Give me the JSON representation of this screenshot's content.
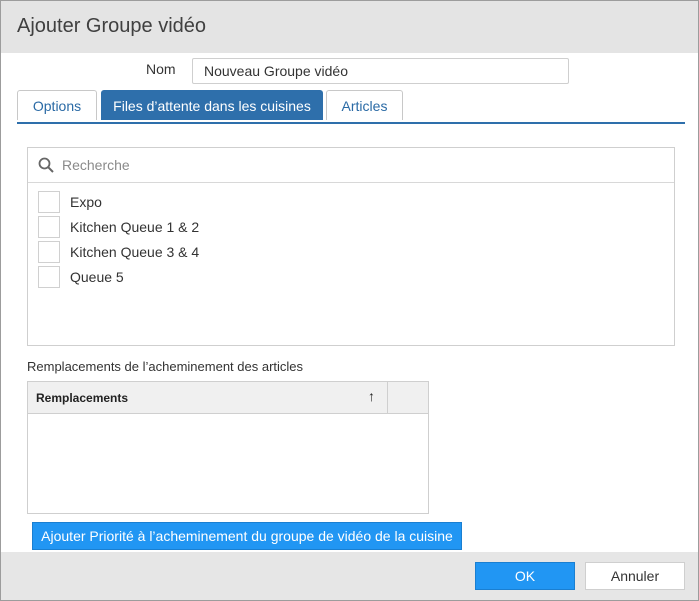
{
  "dialog": {
    "title": "Ajouter Groupe vidéo"
  },
  "name_field": {
    "label": "Nom",
    "value": "Nouveau Groupe vidéo"
  },
  "tabs": [
    {
      "label": "Options",
      "active": false
    },
    {
      "label": "Files d’attente dans les cuisines",
      "active": true
    },
    {
      "label": "Articles",
      "active": false
    }
  ],
  "queue_list": {
    "search_placeholder": "Recherche",
    "items": [
      {
        "label": "Expo",
        "checked": false
      },
      {
        "label": "Kitchen Queue 1 & 2",
        "checked": false
      },
      {
        "label": "Kitchen Queue 3 & 4",
        "checked": false
      },
      {
        "label": "Queue 5",
        "checked": false
      }
    ]
  },
  "overrides": {
    "title": "Remplacements de l’acheminement des articles",
    "column_header": "Remplacements",
    "sort_icon": "arrow-up",
    "rows": []
  },
  "add_button": {
    "label": "Ajouter Priorité à l’acheminement du groupe de vidéo de la cuisine"
  },
  "footer": {
    "ok_label": "OK",
    "cancel_label": "Annuler"
  },
  "colors": {
    "accent": "#2e6fab",
    "primary_button": "#2196f3",
    "titlebar": "#e4e4e4"
  }
}
